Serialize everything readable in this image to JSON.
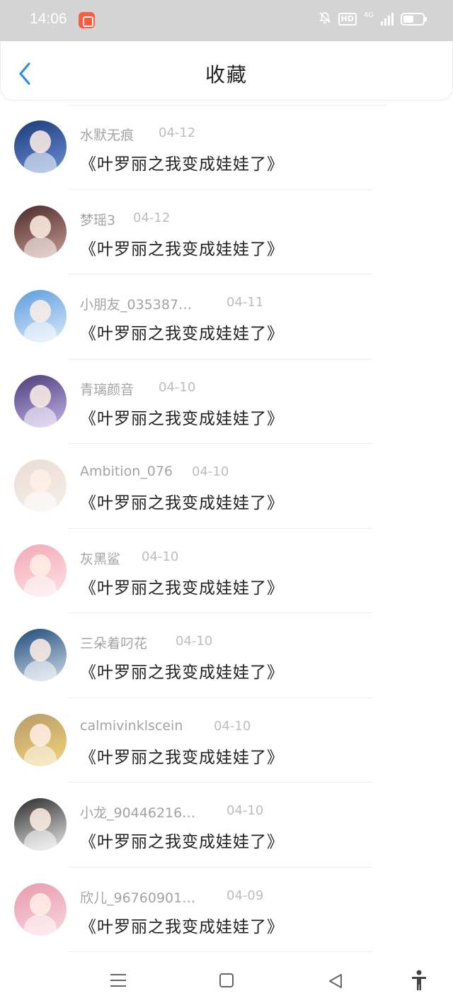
{
  "status_bar": {
    "time": "14:06",
    "hd": "HD",
    "network": "4G"
  },
  "header": {
    "title": "收藏"
  },
  "items": [
    {
      "username": "水默无痕",
      "date": "04-12",
      "content": "《叶罗丽之我变成娃娃了》",
      "avatar_colors": [
        "#1b3a78",
        "#6b8fd6"
      ]
    },
    {
      "username": "梦瑶3",
      "date": "04-12",
      "content": "《叶罗丽之我变成娃娃了》",
      "avatar_colors": [
        "#4a2a2a",
        "#c99b92"
      ]
    },
    {
      "username": "小朋友_035387…",
      "date": "04-11",
      "content": "《叶罗丽之我变成娃娃了》",
      "avatar_colors": [
        "#5a9de0",
        "#dde9f6"
      ]
    },
    {
      "username": "青璃颜音",
      "date": "04-10",
      "content": "《叶罗丽之我变成娃娃了》",
      "avatar_colors": [
        "#4a3c7a",
        "#c4b2e6"
      ]
    },
    {
      "username": "Ambition_076",
      "date": "04-10",
      "content": "《叶罗丽之我变成娃娃了》",
      "avatar_colors": [
        "#e9ddd6",
        "#f7efe9"
      ]
    },
    {
      "username": "灰黑鲨",
      "date": "04-10",
      "content": "《叶罗丽之我变成娃娃了》",
      "avatar_colors": [
        "#f4a8b8",
        "#fde2e6"
      ]
    },
    {
      "username": "三朵着叼花",
      "date": "04-10",
      "content": "《叶罗丽之我变成娃娃了》",
      "avatar_colors": [
        "#1d4a7a",
        "#cfdbe6"
      ]
    },
    {
      "username": "calmivinklscein",
      "date": "04-10",
      "content": "《叶罗丽之我变成娃娃了》",
      "avatar_colors": [
        "#b89a6a",
        "#f2d47a"
      ]
    },
    {
      "username": "小龙_90446216…",
      "date": "04-10",
      "content": "《叶罗丽之我变成娃娃了》",
      "avatar_colors": [
        "#2a2a2a",
        "#e8e8e8"
      ]
    },
    {
      "username": "欣儿_96760901…",
      "date": "04-09",
      "content": "《叶罗丽之我变成娃娃了》",
      "avatar_colors": [
        "#e79ab0",
        "#f9d7df"
      ]
    }
  ],
  "colors": {
    "accent": "#2f8fe6",
    "status_bar_bg": "#d4d4d4",
    "text_primary": "#222222",
    "text_secondary": "#a3a3a3"
  },
  "nav": {
    "menu_icon": "menu-icon",
    "home_icon": "home-square-icon",
    "back_icon": "back-triangle-icon",
    "accessibility_icon": "accessibility-icon"
  }
}
